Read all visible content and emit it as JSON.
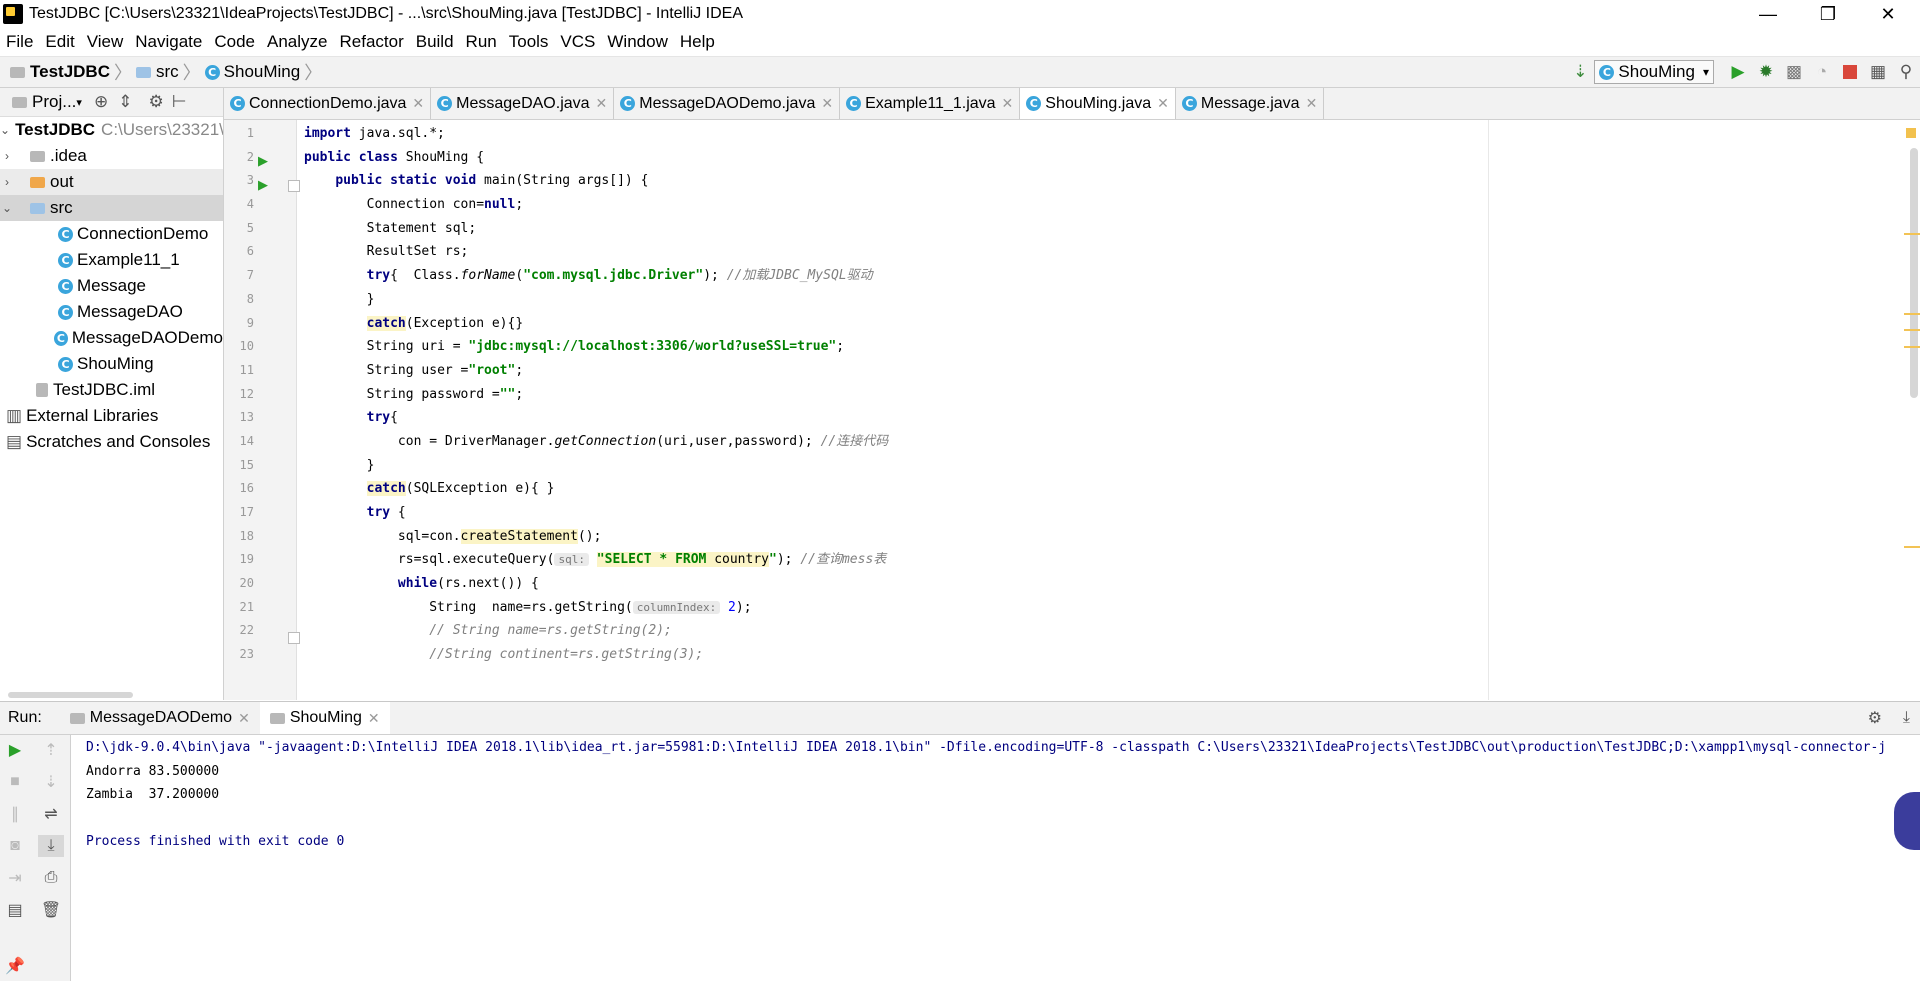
{
  "window": {
    "title": "TestJDBC [C:\\Users\\23321\\IdeaProjects\\TestJDBC] - ...\\src\\ShouMing.java [TestJDBC] - IntelliJ IDEA",
    "min": "—",
    "max": "❐",
    "close": "✕"
  },
  "menu": [
    "File",
    "Edit",
    "View",
    "Navigate",
    "Code",
    "Analyze",
    "Refactor",
    "Build",
    "Run",
    "Tools",
    "VCS",
    "Window",
    "Help"
  ],
  "breadcrumb": {
    "project": "TestJDBC",
    "folder": "src",
    "file": "ShouMing"
  },
  "toolbar": {
    "run_config": "ShouMing"
  },
  "project_panel": {
    "header": "Proj...",
    "tree": [
      {
        "label": "TestJDBC",
        "path": "C:\\Users\\23321\\",
        "kind": "project"
      },
      {
        "label": ".idea",
        "kind": "folder"
      },
      {
        "label": "out",
        "kind": "folder-orange"
      },
      {
        "label": "src",
        "kind": "folder-src"
      },
      {
        "label": "ConnectionDemo",
        "kind": "class"
      },
      {
        "label": "Example11_1",
        "kind": "class"
      },
      {
        "label": "Message",
        "kind": "class"
      },
      {
        "label": "MessageDAO",
        "kind": "class"
      },
      {
        "label": "MessageDAODemo",
        "kind": "class"
      },
      {
        "label": "ShouMing",
        "kind": "class"
      },
      {
        "label": "TestJDBC.iml",
        "kind": "file"
      },
      {
        "label": "External Libraries",
        "kind": "lib"
      },
      {
        "label": "Scratches and Consoles",
        "kind": "scratch"
      }
    ]
  },
  "tabs": [
    "ConnectionDemo.java",
    "MessageDAO.java",
    "MessageDAODemo.java",
    "Example11_1.java",
    "ShouMing.java",
    "Message.java"
  ],
  "active_tab": "ShouMing.java",
  "code": {
    "line_numbers": [
      "1",
      "2",
      "3",
      "4",
      "5",
      "6",
      "7",
      "8",
      "9",
      "10",
      "11",
      "12",
      "13",
      "14",
      "15",
      "16",
      "17",
      "18",
      "19",
      "20",
      "21",
      "22",
      "23"
    ],
    "l1": {
      "kw": "import",
      "rest": " java.sql.*;"
    },
    "l2": {
      "kw": "public class",
      "rest": " ShouMing {"
    },
    "l3": {
      "kw": "public static void",
      "rest": " main(String args[]) {"
    },
    "l4": {
      "a": "Connection con=",
      "kw": "null",
      "b": ";"
    },
    "l5": "Statement sql;",
    "l6": "ResultSet rs;",
    "l7": {
      "kw": "try",
      "a": "{  Class.",
      "m": "forName",
      "b": "(",
      "s": "\"com.mysql.jdbc.Driver\"",
      "c": "); ",
      "cmt": "//加载JDBC_MySQL驱动"
    },
    "l8": "}",
    "l9": {
      "kw": "catch",
      "rest": "(Exception e){}"
    },
    "l10": {
      "a": "String uri = ",
      "s": "\"jdbc:mysql://localhost:3306/world?useSSL=true\"",
      "b": ";"
    },
    "l11": {
      "a": "String user =",
      "s": "\"root\"",
      "b": ";"
    },
    "l12": {
      "a": "String password =",
      "s": "\"\"",
      "b": ";"
    },
    "l13": {
      "kw": "try",
      "rest": "{"
    },
    "l14": {
      "a": "con = DriverManager.",
      "m": "getConnection",
      "b": "(uri,user,password); ",
      "cmt": "//连接代码"
    },
    "l15": "}",
    "l16": {
      "kw": "catch",
      "rest": "(SQLException e){ }"
    },
    "l17": {
      "kw": "try",
      "rest": " {"
    },
    "l18": {
      "a": "sql=con.",
      "h": "createStatement",
      "b": "();"
    },
    "l19": {
      "a": "rs=sql.executeQuery(",
      "hint": "sql:",
      "s": "\"SELECT * FROM",
      "s2": " country",
      "s3": "\"",
      "b": "); ",
      "cmt": "//查询mess表"
    },
    "l20": {
      "kw": "while",
      "rest": "(rs.next()) {"
    },
    "l21": {
      "a": "String  name=rs.getString(",
      "hint": "columnIndex:",
      "n": "2",
      "b": ");"
    },
    "l22": "// String name=rs.getString(2);",
    "l23": "//String continent=rs.getString(3);"
  },
  "run_panel": {
    "label": "Run:",
    "tabs": [
      "MessageDAODemo",
      "ShouMing"
    ],
    "console": [
      "D:\\jdk-9.0.4\\bin\\java \"-javaagent:D:\\IntelliJ IDEA 2018.1\\lib\\idea_rt.jar=55981:D:\\IntelliJ IDEA 2018.1\\bin\" -Dfile.encoding=UTF-8 -classpath C:\\Users\\23321\\IdeaProjects\\TestJDBC\\out\\production\\TestJDBC;D:\\xampp1\\mysql-connector-j",
      "Andorra 83.500000",
      "Zambia  37.200000",
      "",
      "Process finished with exit code 0"
    ]
  }
}
